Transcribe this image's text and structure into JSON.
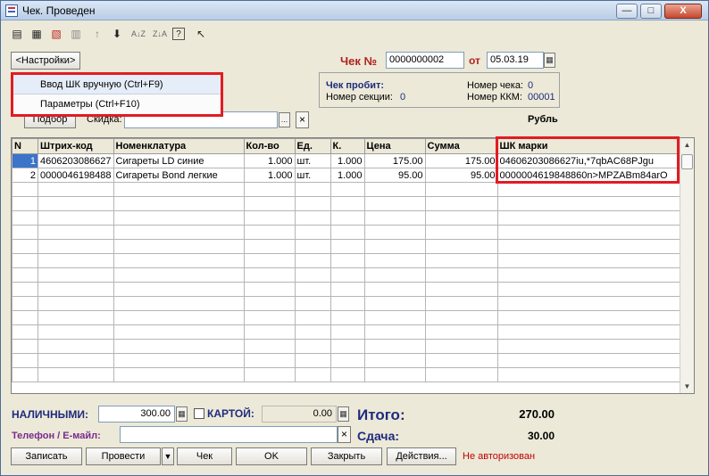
{
  "window": {
    "title": "Чек. Проведен",
    "buttons": {
      "minimize": "—",
      "maximize": "□",
      "close": "X"
    }
  },
  "toolbar": {
    "icons": [
      "new-row-icon",
      "edit-row-icon",
      "delete-row-icon",
      "copy-row-icon",
      "move-up-icon",
      "move-down-icon",
      "sort-asc-icon",
      "sort-desc-icon",
      "help-icon",
      "whats-this-icon"
    ]
  },
  "header": {
    "settings_label": "<Настройки>",
    "check_no_label": "Чек №",
    "check_no": "0000000002",
    "date_label": "от",
    "date": "05.03.19",
    "currency": "Рубль"
  },
  "menu": {
    "items": [
      "Ввод ШК вручную (Ctrl+F9)",
      "Параметры (Ctrl+F10)"
    ]
  },
  "status": {
    "check_printed_label": "Чек пробит:",
    "section_label": "Номер секции:",
    "section": "0",
    "check_no_label": "Номер чека:",
    "check_no": "0",
    "kkm_label": "Номер ККМ:",
    "kkm": "00001"
  },
  "filter": {
    "pick_label": "Подбор",
    "discount_label": "Скидка:",
    "discount_value": ""
  },
  "table": {
    "columns": [
      "N",
      "Штрих-код",
      "Номенклатура",
      "Кол-во",
      "Ед.",
      "К.",
      "Цена",
      "Сумма",
      "ШК марки"
    ],
    "rows": [
      [
        "1",
        "4606203086627",
        "Сигареты LD синие",
        "1.000",
        "шт.",
        "1.000",
        "175.00",
        "175.00",
        "04606203086627iu,*7qbAC68PJgu"
      ],
      [
        "2",
        "0000046198488",
        "Сигареты Bond легкие",
        "1.000",
        "шт.",
        "1.000",
        "95.00",
        "95.00",
        "0000004619848860n>MPZABm84arO"
      ]
    ]
  },
  "payment": {
    "cash_label": "НАЛИЧНЫМИ:",
    "cash": "300.00",
    "card_label": "КАРТОЙ:",
    "card": "0.00",
    "phone_label": "Телефон / E-майл:",
    "phone": "",
    "total_label": "Итого:",
    "total": "270.00",
    "change_label": "Сдача:",
    "change": "30.00"
  },
  "footer": {
    "record": "Записать",
    "post": "Провести",
    "check": "Чек",
    "ok": "OK",
    "close": "Закрыть",
    "actions": "Действия...",
    "auth_status": "Не авторизован"
  },
  "colors": {
    "accent_red": "#e21c23",
    "label_blue": "#1f2b7d",
    "label_purple": "#7a2a8e",
    "title_red": "#b0221d",
    "status_red": "#c00000"
  }
}
